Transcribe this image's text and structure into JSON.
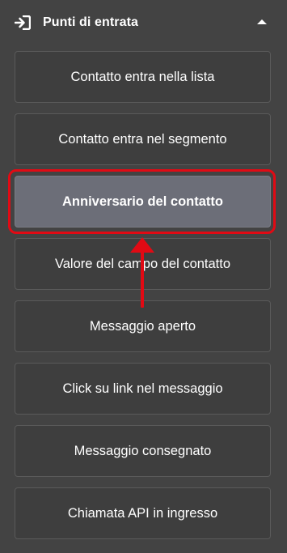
{
  "header": {
    "title": "Punti di entrata",
    "icon": "login-arrow-icon",
    "toggle_icon": "chevron-up-icon"
  },
  "entry_points": [
    {
      "label": "Contatto entra nella lista",
      "selected": false
    },
    {
      "label": "Contatto entra nel segmento",
      "selected": false
    },
    {
      "label": "Anniversario del contatto",
      "selected": true
    },
    {
      "label": "Valore del campo del contatto",
      "selected": false
    },
    {
      "label": "Messaggio aperto",
      "selected": false
    },
    {
      "label": "Click su link nel messaggio",
      "selected": false
    },
    {
      "label": "Messaggio consegnato",
      "selected": false
    },
    {
      "label": "Chiamata API in ingresso",
      "selected": false
    }
  ],
  "colors": {
    "background": "#434343",
    "button_bg": "#3e3e3e",
    "selected_bg": "#6c6e78",
    "annotation_red": "#e10a14"
  }
}
